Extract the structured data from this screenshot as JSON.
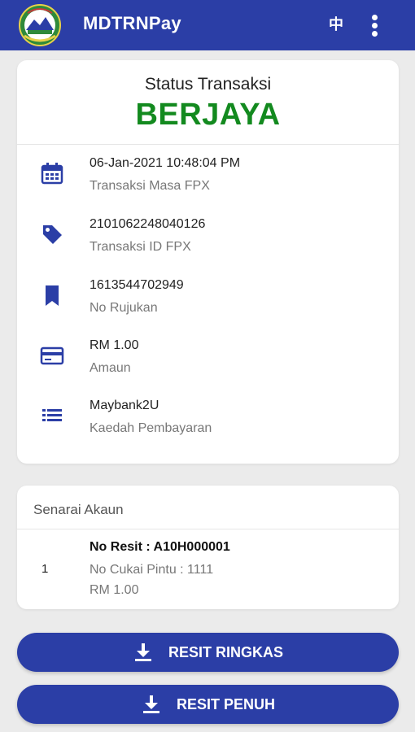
{
  "app": {
    "title": "MDTRNPay",
    "lang_label": "中"
  },
  "colors": {
    "primary": "#2b3ea6",
    "success": "#138a1f"
  },
  "status": {
    "label": "Status Transaksi",
    "value": "BERJAYA"
  },
  "details": [
    {
      "icon": "calendar-icon",
      "value": "06-Jan-2021 10:48:04 PM",
      "label": "Transaksi Masa FPX"
    },
    {
      "icon": "tag-icon",
      "value": "2101062248040126",
      "label": "Transaksi ID FPX"
    },
    {
      "icon": "bookmark-icon",
      "value": "1613544702949",
      "label": "No Rujukan"
    },
    {
      "icon": "credit-card-icon",
      "value": "RM 1.00",
      "label": "Amaun"
    },
    {
      "icon": "list-icon",
      "value": "Maybank2U",
      "label": "Kaedah Pembayaran"
    }
  ],
  "accounts": {
    "title": "Senarai Akaun",
    "items": [
      {
        "index": "1",
        "resit": "No Resit : A10H000001",
        "cukai": "No Cukai Pintu : 1111",
        "amount": "RM 1.00"
      }
    ]
  },
  "buttons": {
    "ringkas": "RESIT RINGKAS",
    "penuh": "RESIT PENUH"
  }
}
